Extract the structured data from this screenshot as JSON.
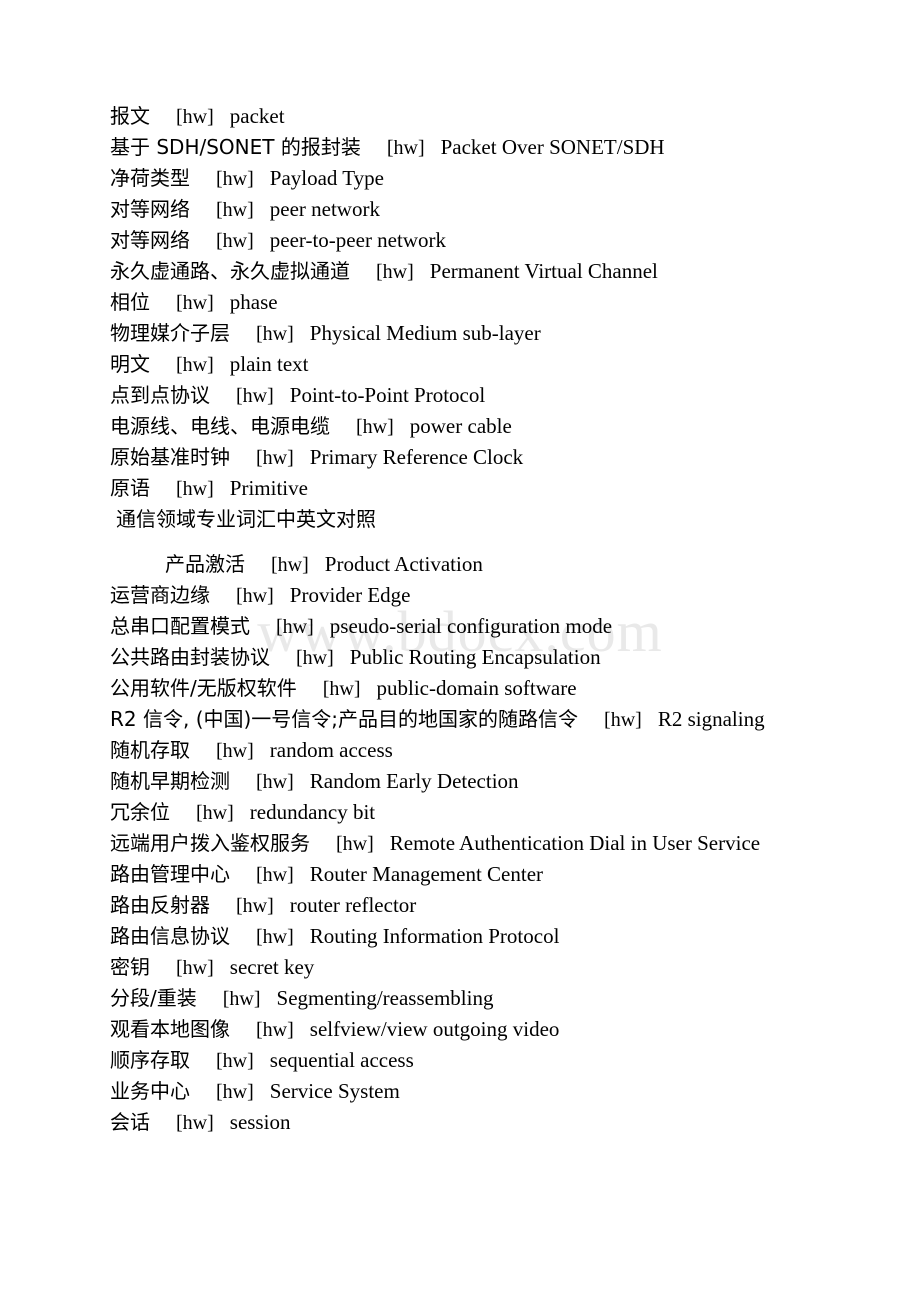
{
  "document": {
    "watermark": "www.bdocx.com",
    "section_caption": "通信领域专业词汇中英文对照",
    "tag": "[hw]",
    "entries": [
      {
        "cn": "报文",
        "tag": "[hw]",
        "en": "packet"
      },
      {
        "cn": "基于 SDH/SONET 的报封装",
        "tag": "[hw]",
        "en": "Packet Over SONET/SDH"
      },
      {
        "cn": "净荷类型",
        "tag": "[hw]",
        "en": "Payload Type"
      },
      {
        "cn": "对等网络",
        "tag": "[hw]",
        "en": "peer network"
      },
      {
        "cn": "对等网络",
        "tag": "[hw]",
        "en": "peer-to-peer network"
      },
      {
        "cn": "永久虚通路、永久虚拟通道",
        "tag": "[hw]",
        "en": "Permanent Virtual Channel"
      },
      {
        "cn": "相位",
        "tag": "[hw]",
        "en": "phase"
      },
      {
        "cn": "物理媒介子层",
        "tag": "[hw]",
        "en": "Physical Medium sub-layer"
      },
      {
        "cn": "明文",
        "tag": "[hw]",
        "en": "plain text"
      },
      {
        "cn": "点到点协议",
        "tag": "[hw]",
        "en": "Point-to-Point Protocol"
      },
      {
        "cn": "电源线、电线、电源电缆",
        "tag": "[hw]",
        "en": "power cable"
      },
      {
        "cn": "原始基准时钟",
        "tag": "[hw]",
        "en": "Primary Reference Clock"
      },
      {
        "cn": "原语",
        "tag": "[hw]",
        "en": "Primitive"
      },
      {
        "cn": "产品激活",
        "tag": "[hw]",
        "en": "Product Activation"
      },
      {
        "cn": "运营商边缘",
        "tag": "[hw]",
        "en": "Provider Edge"
      },
      {
        "cn": "总串口配置模式",
        "tag": "[hw]",
        "en": "pseudo-serial configuration mode"
      },
      {
        "cn": "公共路由封装协议",
        "tag": "[hw]",
        "en": "Public Routing Encapsulation"
      },
      {
        "cn": "公用软件/无版权软件",
        "tag": "[hw]",
        "en": "public-domain software"
      },
      {
        "cn": "R2 信令, (中国)一号信令;产品目的地国家的随路信令",
        "tag": "[hw]",
        "en": "R2 signaling"
      },
      {
        "cn": "随机存取",
        "tag": "[hw]",
        "en": "random access"
      },
      {
        "cn": "随机早期检测",
        "tag": "[hw]",
        "en": "Random Early Detection"
      },
      {
        "cn": "冗余位",
        "tag": "[hw]",
        "en": "redundancy bit"
      },
      {
        "cn": "远端用户拨入鉴权服务",
        "tag": "[hw]",
        "en": "Remote Authentication Dial in User Service"
      },
      {
        "cn": "路由管理中心",
        "tag": "[hw]",
        "en": "Router Management Center"
      },
      {
        "cn": "路由反射器",
        "tag": "[hw]",
        "en": "router reflector"
      },
      {
        "cn": "路由信息协议",
        "tag": "[hw]",
        "en": "Routing Information Protocol"
      },
      {
        "cn": "密钥",
        "tag": "[hw]",
        "en": "secret key"
      },
      {
        "cn": "分段/重装",
        "tag": "[hw]",
        "en": "Segmenting/reassembling"
      },
      {
        "cn": "观看本地图像",
        "tag": "[hw]",
        "en": "selfview/view outgoing video"
      },
      {
        "cn": "顺序存取",
        "tag": "[hw]",
        "en": "sequential access"
      },
      {
        "cn": "业务中心",
        "tag": "[hw]",
        "en": "Service System"
      },
      {
        "cn": "会话",
        "tag": "[hw]",
        "en": "session"
      }
    ]
  }
}
